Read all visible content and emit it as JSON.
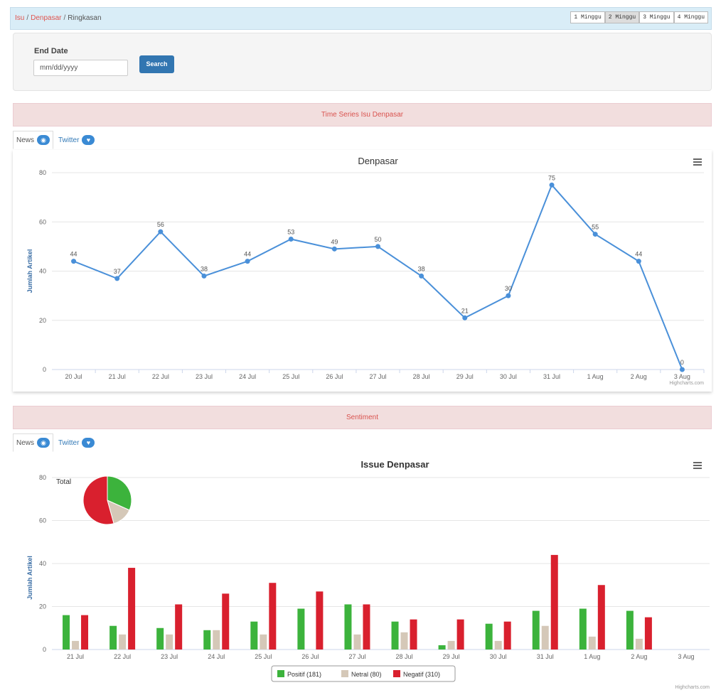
{
  "breadcrumb": {
    "items": [
      "Isu",
      "Denpasar"
    ],
    "separator": "/",
    "current": "Ringkasan"
  },
  "range": {
    "options": [
      "1 Minggu",
      "2 Minggu",
      "3 Minggu",
      "4 Minggu"
    ],
    "active_index": 1
  },
  "filter": {
    "label": "End Date",
    "placeholder": "mm/dd/yyyy",
    "search_label": "Search"
  },
  "sections": {
    "timeseries_title": "Time Series Isu Denpasar",
    "sentiment_title": "Sentiment"
  },
  "tabs": {
    "news": "News",
    "twitter": "Twitter"
  },
  "credit": "Highcharts.com",
  "colors": {
    "line": "#4a90d9",
    "positif": "#3cb33c",
    "netral": "#d5c8b8",
    "negatif": "#d9202e",
    "link": "#337ab7",
    "danger": "#d9534f"
  },
  "chart_data": [
    {
      "type": "line",
      "title": "Denpasar",
      "ylabel": "Jumlah Artikel",
      "ylim": [
        0,
        80
      ],
      "yticks": [
        0,
        20,
        40,
        60,
        80
      ],
      "categories": [
        "20 Jul",
        "21 Jul",
        "22 Jul",
        "23 Jul",
        "24 Jul",
        "25 Jul",
        "26 Jul",
        "27 Jul",
        "28 Jul",
        "29 Jul",
        "30 Jul",
        "31 Jul",
        "1 Aug",
        "2 Aug",
        "3 Aug"
      ],
      "values": [
        44,
        37,
        56,
        38,
        44,
        53,
        49,
        50,
        38,
        21,
        30,
        75,
        55,
        44,
        0
      ],
      "data_labels": true
    },
    {
      "type": "bar",
      "title": "Issue Denpasar",
      "ylabel": "Jumlah Artikel",
      "ylim": [
        0,
        80
      ],
      "yticks": [
        0,
        20,
        40,
        60,
        80
      ],
      "categories": [
        "21 Jul",
        "22 Jul",
        "23 Jul",
        "24 Jul",
        "25 Jul",
        "26 Jul",
        "27 Jul",
        "28 Jul",
        "29 Jul",
        "30 Jul",
        "31 Jul",
        "1 Aug",
        "2 Aug",
        "3 Aug"
      ],
      "series": [
        {
          "name": "Positif (181)",
          "color": "#3cb33c",
          "values": [
            16,
            11,
            10,
            9,
            13,
            19,
            21,
            13,
            2,
            12,
            18,
            19,
            18,
            0
          ]
        },
        {
          "name": "Netral (80)",
          "color": "#d5c8b8",
          "values": [
            4,
            7,
            7,
            9,
            7,
            0,
            7,
            8,
            4,
            4,
            11,
            6,
            5,
            0
          ]
        },
        {
          "name": "Negatif (310)",
          "color": "#d9202e",
          "values": [
            16,
            38,
            21,
            26,
            31,
            27,
            21,
            14,
            14,
            13,
            44,
            30,
            15,
            0
          ]
        }
      ],
      "legend_position": "bottom",
      "pie": {
        "label": "Total",
        "values": [
          181,
          80,
          310
        ],
        "colors": [
          "#3cb33c",
          "#d5c8b8",
          "#d9202e"
        ]
      }
    }
  ]
}
